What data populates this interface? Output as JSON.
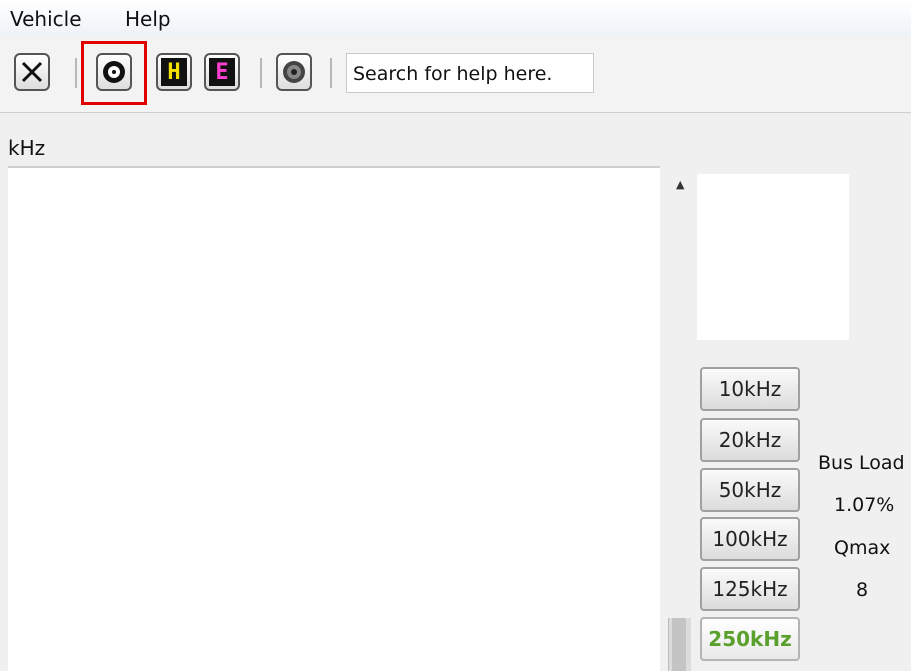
{
  "menu": {
    "items": [
      "Vehicle",
      "Help"
    ]
  },
  "toolbar": {
    "search_placeholder": "Search for help here.",
    "h_label": "H",
    "e_label": "E"
  },
  "tab": {
    "label": "kHz"
  },
  "rates": {
    "items": [
      "10kHz",
      "20kHz",
      "50kHz",
      "100kHz",
      "125kHz",
      "250kHz"
    ],
    "selected": "250kHz",
    "selected_color": "#5aa02c"
  },
  "stats": {
    "bus_load_label": "Bus Load",
    "bus_load_value": "1.07%",
    "qmax_label": "Qmax",
    "qmax_value": "8"
  },
  "icons": {
    "close": "close-icon",
    "connect": "connector-icon",
    "h": "h-icon",
    "e": "e-icon",
    "settings": "dial-icon"
  }
}
